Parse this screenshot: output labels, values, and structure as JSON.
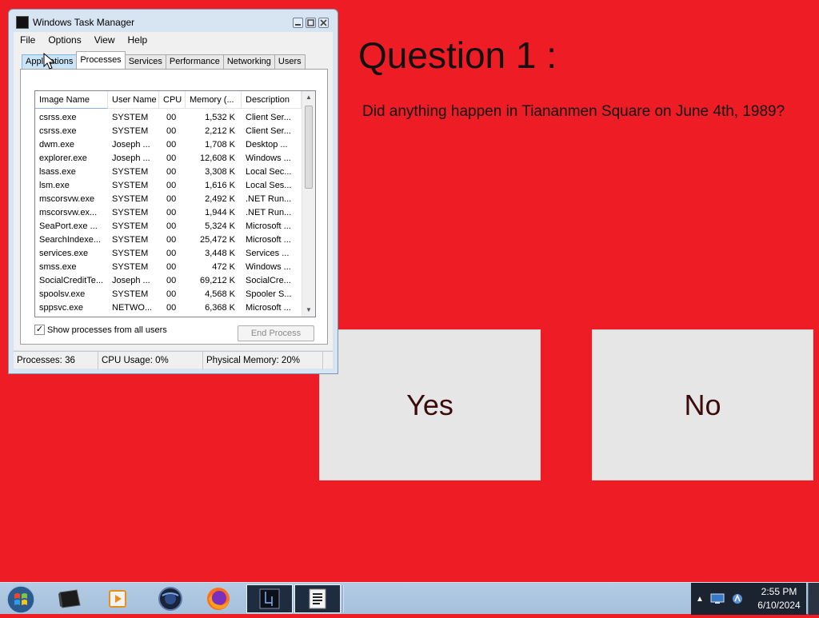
{
  "quiz": {
    "title": "Question 1 :",
    "question": "Did anything happen in Tiananmen Square on June 4th, 1989?",
    "answers": {
      "yes": "Yes",
      "no": "No"
    },
    "colors": {
      "background": "#ee1c25",
      "button": "#e6e6e6",
      "button_text": "#3b0b0b"
    }
  },
  "task_manager": {
    "title": "Windows Task Manager",
    "menu": [
      "File",
      "Options",
      "View",
      "Help"
    ],
    "tabs": [
      "Applications",
      "Processes",
      "Services",
      "Performance",
      "Networking",
      "Users"
    ],
    "active_tab": "Processes",
    "columns": [
      "Image Name",
      "User Name",
      "CPU",
      "Memory (...",
      "Description"
    ],
    "rows": [
      {
        "name": "csrss.exe",
        "user": "SYSTEM",
        "cpu": "00",
        "mem": "1,532 K",
        "desc": "Client Ser..."
      },
      {
        "name": "csrss.exe",
        "user": "SYSTEM",
        "cpu": "00",
        "mem": "2,212 K",
        "desc": "Client Ser..."
      },
      {
        "name": "dwm.exe",
        "user": "Joseph ...",
        "cpu": "00",
        "mem": "1,708 K",
        "desc": "Desktop ..."
      },
      {
        "name": "explorer.exe",
        "user": "Joseph ...",
        "cpu": "00",
        "mem": "12,608 K",
        "desc": "Windows ..."
      },
      {
        "name": "lsass.exe",
        "user": "SYSTEM",
        "cpu": "00",
        "mem": "3,308 K",
        "desc": "Local Sec..."
      },
      {
        "name": "lsm.exe",
        "user": "SYSTEM",
        "cpu": "00",
        "mem": "1,616 K",
        "desc": "Local Ses..."
      },
      {
        "name": "mscorsvw.exe",
        "user": "SYSTEM",
        "cpu": "00",
        "mem": "2,492 K",
        "desc": ".NET Run..."
      },
      {
        "name": "mscorsvw.ex...",
        "user": "SYSTEM",
        "cpu": "00",
        "mem": "1,944 K",
        "desc": ".NET Run..."
      },
      {
        "name": "SeaPort.exe ...",
        "user": "SYSTEM",
        "cpu": "00",
        "mem": "5,324 K",
        "desc": "Microsoft ..."
      },
      {
        "name": "SearchIndexe...",
        "user": "SYSTEM",
        "cpu": "00",
        "mem": "25,472 K",
        "desc": "Microsoft ..."
      },
      {
        "name": "services.exe",
        "user": "SYSTEM",
        "cpu": "00",
        "mem": "3,448 K",
        "desc": "Services ..."
      },
      {
        "name": "smss.exe",
        "user": "SYSTEM",
        "cpu": "00",
        "mem": "472 K",
        "desc": "Windows ..."
      },
      {
        "name": "SocialCreditTe...",
        "user": "Joseph ...",
        "cpu": "00",
        "mem": "69,212 K",
        "desc": "SocialCre..."
      },
      {
        "name": "spoolsv.exe",
        "user": "SYSTEM",
        "cpu": "00",
        "mem": "4,568 K",
        "desc": "Spooler S..."
      },
      {
        "name": "sppsvc.exe",
        "user": "NETWO...",
        "cpu": "00",
        "mem": "6,368 K",
        "desc": "Microsoft ..."
      }
    ],
    "show_all_users_label": "Show processes from all users",
    "show_all_users_checked": true,
    "end_process_label": "End Process",
    "status": {
      "processes": "Processes: 36",
      "cpu": "CPU Usage: 0%",
      "memory": "Physical Memory: 20%"
    }
  },
  "taskbar": {
    "items": [
      "terminal-icon",
      "media-player-icon",
      "browser-icon",
      "firefox-icon",
      "task-manager-icon",
      "document-icon"
    ],
    "clock": {
      "time": "2:55 PM",
      "date": "6/10/2024"
    }
  }
}
